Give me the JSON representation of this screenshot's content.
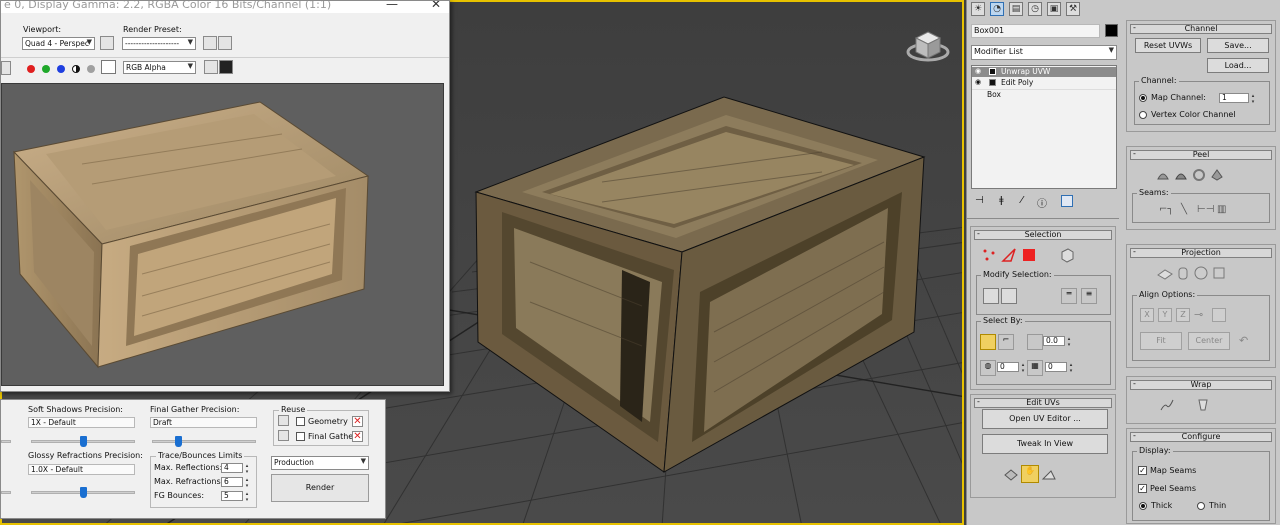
{
  "render_window": {
    "title": "e 0, Display Gamma: 2.2, RGBA Color 16 Bits/Channel (1:1)",
    "viewport_label": "Viewport:",
    "viewport_value": "Quad 4 - Perspec",
    "render_preset_label": "Render Preset:",
    "render_preset_value": "--------------------",
    "channel_value": "RGB Alpha"
  },
  "render_settings": {
    "soft_shadows_label": "Soft Shadows Precision:",
    "soft_shadows_value": "1X - Default",
    "soft_shadows_level": 0.5,
    "glossy_refractions_label": "Glossy Refractions Precision:",
    "glossy_refractions_value": "1.0X - Default",
    "glossy_refractions_level": 0.5,
    "final_gather_label": "Final Gather Precision:",
    "final_gather_value": "Draft",
    "final_gather_level": 0.25,
    "trace_group_label": "Trace/Bounces Limits",
    "max_reflections_label": "Max. Reflections:",
    "max_reflections_value": "4",
    "max_refractions_label": "Max. Refractions:",
    "max_refractions_value": "6",
    "fg_bounces_label": "FG Bounces:",
    "fg_bounces_value": "5",
    "reuse_label": "Reuse",
    "geometry_label": "Geometry",
    "final_gather_chk_label": "Final Gather",
    "production_value": "Production",
    "render_button": "Render"
  },
  "command_panel": {
    "object_name": "Box001",
    "modifier_list_label": "Modifier List",
    "modifier_stack": [
      "Unwrap UVW",
      "Edit Poly",
      "Box"
    ],
    "selection": {
      "title": "Selection",
      "modify_selection_label": "Modify Selection:",
      "select_by_label": "Select By:",
      "angle_value_1": "0.0",
      "value_2": "0",
      "value_3": "0"
    },
    "edit_uvs": {
      "title": "Edit UVs",
      "open_uv_editor": "Open UV Editor ...",
      "tweak_in_view": "Tweak In View"
    },
    "channel": {
      "title": "Channel",
      "reset_uvws": "Reset UVWs",
      "save": "Save...",
      "load": "Load...",
      "channel_group_label": "Channel:",
      "map_channel_label": "Map Channel:",
      "map_channel_value": "1",
      "vertex_color_channel_label": "Vertex Color Channel"
    },
    "peel": {
      "title": "Peel",
      "seams_label": "Seams:"
    },
    "projection": {
      "title": "Projection",
      "align_options_label": "Align Options:",
      "x": "X",
      "y": "Y",
      "z": "Z",
      "fit": "Fit",
      "center": "Center"
    },
    "wrap": {
      "title": "Wrap"
    },
    "configure": {
      "title": "Configure",
      "display_label": "Display:",
      "map_seams_label": "Map Seams",
      "peel_seams_label": "Peel Seams",
      "thick_label": "Thick",
      "thin_label": "Thin"
    }
  },
  "colors": {
    "viewport_bg": "#434343",
    "active_border": "#e7c200",
    "slider_blue": "#1a6fd1",
    "panel_bg": "#c8c8c8"
  }
}
